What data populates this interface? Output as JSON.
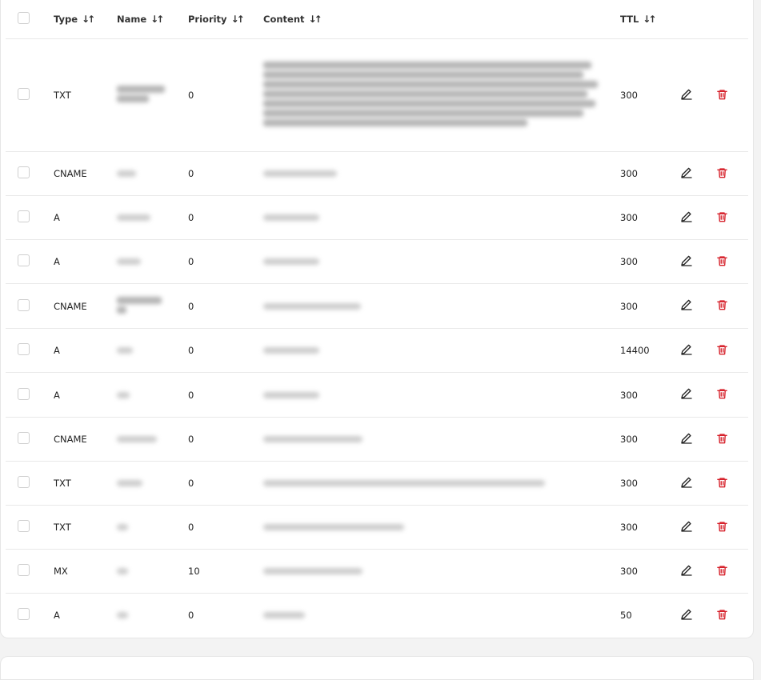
{
  "columns": {
    "type": "Type",
    "name": "Name",
    "priority": "Priority",
    "content": "Content",
    "ttl": "TTL",
    "sort_glyph": "↓↑"
  },
  "colors": {
    "delete": "#d6202a",
    "edit": "#222222"
  },
  "rows": [
    {
      "type": "TXT",
      "priority": "0",
      "ttl": "300"
    },
    {
      "type": "CNAME",
      "priority": "0",
      "ttl": "300"
    },
    {
      "type": "A",
      "priority": "0",
      "ttl": "300"
    },
    {
      "type": "A",
      "priority": "0",
      "ttl": "300"
    },
    {
      "type": "CNAME",
      "priority": "0",
      "ttl": "300"
    },
    {
      "type": "A",
      "priority": "0",
      "ttl": "14400"
    },
    {
      "type": "A",
      "priority": "0",
      "ttl": "300"
    },
    {
      "type": "CNAME",
      "priority": "0",
      "ttl": "300"
    },
    {
      "type": "TXT",
      "priority": "0",
      "ttl": "300"
    },
    {
      "type": "TXT",
      "priority": "0",
      "ttl": "300"
    },
    {
      "type": "MX",
      "priority": "10",
      "ttl": "300"
    },
    {
      "type": "A",
      "priority": "0",
      "ttl": "50"
    }
  ]
}
